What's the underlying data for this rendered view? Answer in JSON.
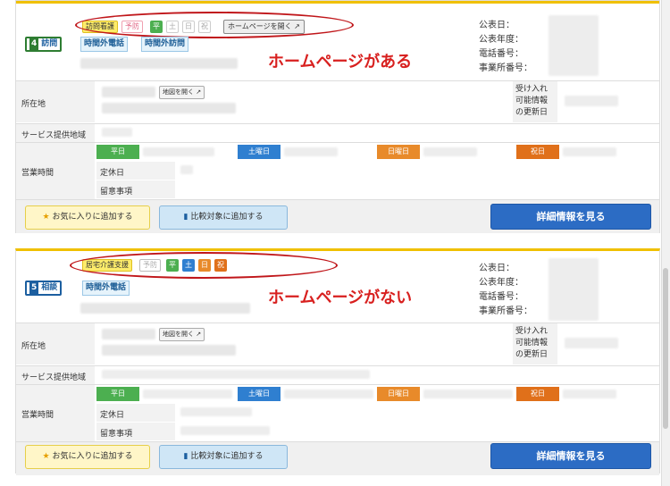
{
  "colors": {
    "accent_yellow": "#f0c000",
    "annotation_red": "#d8201f",
    "weekday_green": "#4caf50",
    "saturday_blue": "#2f7fd0",
    "sunday_orange": "#e88a2a",
    "holiday_orange": "#e0701a",
    "detail_blue": "#2c6cc4"
  },
  "cards": [
    {
      "service_tags": [
        "訪問看護",
        "予防"
      ],
      "days": [
        "平",
        "土",
        "日",
        "祝"
      ],
      "homepage_button": "ホームページを開く",
      "service_badge": {
        "number": "4",
        "label": "訪問"
      },
      "blue_tags": [
        "時間外電話",
        "時間外訪問"
      ],
      "annotation": "ホームページがある",
      "info_labels": [
        "公表日：",
        "公表年度：",
        "電話番号：",
        "事業所番号："
      ],
      "rows": {
        "location": "所在地",
        "map_button": "地図を開く",
        "accept_label": [
          "受け入れ",
          "可能情報",
          "の更新日"
        ],
        "area": "サービス提供地域",
        "hours": "営業時間",
        "holiday": "定休日",
        "notes": "留意事項"
      },
      "day_heads": [
        "平日",
        "土曜日",
        "日曜日",
        "祝日"
      ],
      "fav_button": "お気に入りに追加する",
      "compare_button": "比較対象に追加する",
      "detail_button": "詳細情報を見る"
    },
    {
      "service_tags": [
        "居宅介護支援",
        "予防"
      ],
      "days": [
        "平",
        "土",
        "日",
        "祝"
      ],
      "service_badge": {
        "number": "5",
        "label": "相談"
      },
      "blue_tags": [
        "時間外電話"
      ],
      "annotation": "ホームページがない",
      "info_labels": [
        "公表日：",
        "公表年度：",
        "電話番号：",
        "事業所番号："
      ],
      "rows": {
        "location": "所在地",
        "map_button": "地図を開く",
        "accept_label": [
          "受け入れ",
          "可能情報",
          "の更新日"
        ],
        "area": "サービス提供地域",
        "hours": "営業時間",
        "holiday": "定休日",
        "notes": "留意事項"
      },
      "day_heads": [
        "平日",
        "土曜日",
        "日曜日",
        "祝日"
      ],
      "fav_button": "お気に入りに追加する",
      "compare_button": "比較対象に追加する",
      "detail_button": "詳細情報を見る"
    }
  ]
}
